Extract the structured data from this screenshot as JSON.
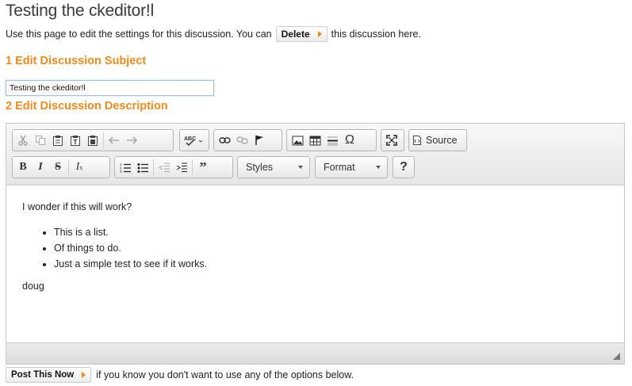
{
  "page": {
    "title": "Testing the ckeditor!l",
    "intro_before": "Use this page to edit the settings for this discussion. You can",
    "delete_label": "Delete",
    "intro_after": "this discussion here."
  },
  "sections": {
    "subject_heading": "1 Edit Discussion Subject",
    "subject_value": "Testing the ckeditor!l",
    "description_heading": "2 Edit Discussion Description"
  },
  "toolbar": {
    "source_label": "Source",
    "styles_label": "Styles",
    "format_label": "Format",
    "help_label": "?"
  },
  "content": {
    "intro": "I wonder if this will work?",
    "list": [
      "This is  a list.",
      "Of things to do.",
      "Just a simple test to see if it works."
    ],
    "signature": "doug"
  },
  "footer": {
    "post_label": "Post This Now",
    "post_note": "if you know you don't want to use any of the options below."
  },
  "colors": {
    "accent": "#f08a1c",
    "title": "#3a3a3a"
  }
}
